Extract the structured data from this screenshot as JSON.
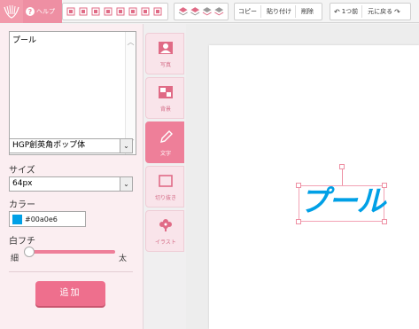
{
  "toolbar": {
    "help_label": "ヘルプ",
    "edit_buttons": [
      "コピー",
      "貼り付け",
      "削除"
    ],
    "history_buttons": [
      "1つ前",
      "元に戻る"
    ]
  },
  "left_panel": {
    "text_value": "プール",
    "font_select": "HGP創英角ポップ体",
    "size_label": "サイズ",
    "size_value": "64px",
    "color_label": "カラー",
    "color_value": "#00a0e6",
    "outline_label": "白フチ",
    "slider_min_label": "細",
    "slider_max_label": "太",
    "slider_level": 0,
    "add_button": "追加"
  },
  "tabs": [
    {
      "label": "写真",
      "icon": "photo-icon",
      "active": false
    },
    {
      "label": "背景",
      "icon": "background-icon",
      "active": false
    },
    {
      "label": "文字",
      "icon": "pencil-icon",
      "active": true
    },
    {
      "label": "切り抜き",
      "icon": "crop-icon",
      "active": false
    },
    {
      "label": "イラスト",
      "icon": "flower-icon",
      "active": false
    }
  ],
  "canvas": {
    "text": "プール",
    "text_color": "#00a0e6"
  },
  "colors": {
    "accent": "#ee7f99",
    "panel_bg": "#fbeef1"
  }
}
